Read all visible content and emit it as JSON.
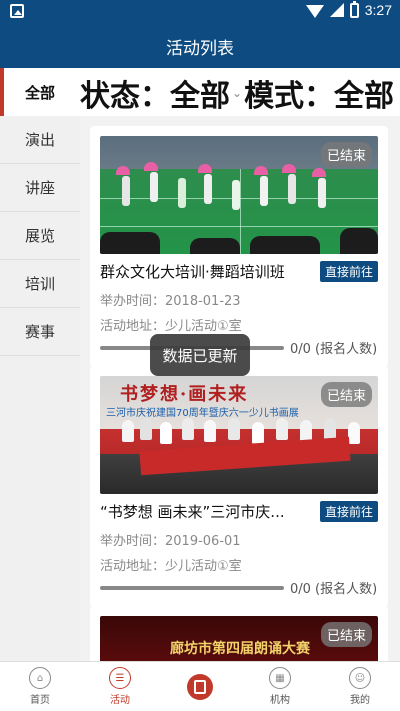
{
  "status_bar": {
    "time": "3:27"
  },
  "app_bar": {
    "title": "活动列表"
  },
  "filter": {
    "all_tab": "全部",
    "status_text": "状态：全部",
    "mode_text": "模式：全部"
  },
  "sidebar": {
    "items": [
      {
        "label": "演出"
      },
      {
        "label": "讲座"
      },
      {
        "label": "展览"
      },
      {
        "label": "培训"
      },
      {
        "label": "赛事"
      }
    ]
  },
  "cards": [
    {
      "badge": "已结束",
      "title": "群众文化大培训·舞蹈培训班",
      "button": "直接前往",
      "time": "举办时间：2018-01-23",
      "location": "活动地址：少儿活动①室",
      "progress": 0,
      "progress_label": "0/0 (报名人数)"
    },
    {
      "badge": "已结束",
      "title": "“书梦想 画未来”三河市庆...",
      "button": "直接前往",
      "time": "举办时间：2019-06-01",
      "location": "活动地址：少儿活动①室",
      "progress": 0,
      "progress_label": "0/0 (报名人数)",
      "image_text_main": "书梦想·画未来",
      "image_text_sub": "三河市庆祝建国70周年暨庆六一少儿书画展"
    },
    {
      "badge": "已结束",
      "image_text_main": "廊坊市第四届朗诵大赛"
    }
  ],
  "toast": {
    "text": "数据已更新"
  },
  "bottom_nav": {
    "items": [
      {
        "label": "首页",
        "icon": "home-icon"
      },
      {
        "label": "活动",
        "icon": "activity-icon"
      },
      {
        "label": "",
        "icon": "scan-icon"
      },
      {
        "label": "机构",
        "icon": "organization-icon"
      },
      {
        "label": "我的",
        "icon": "profile-icon"
      }
    ],
    "active_index": 1
  },
  "colors": {
    "primary": "#0e4b80",
    "accent": "#c0392b"
  }
}
